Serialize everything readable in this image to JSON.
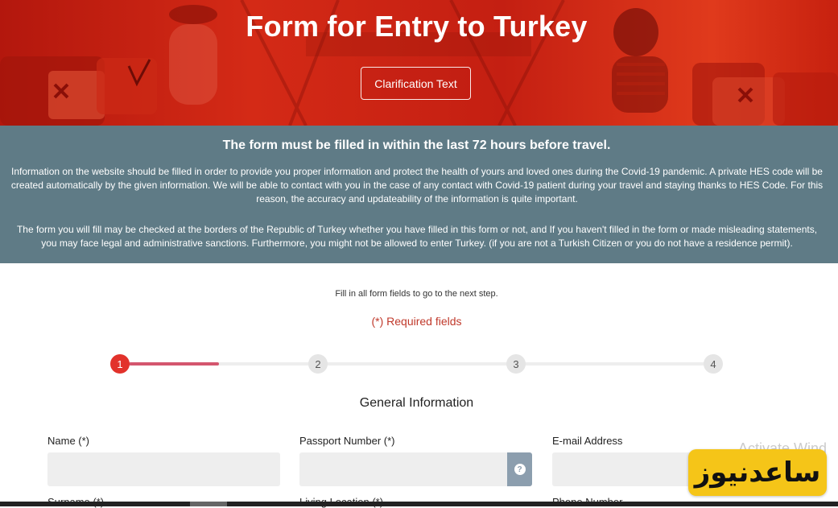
{
  "hero": {
    "title": "Form for Entry to Turkey",
    "clarification_button": "Clarification Text"
  },
  "info": {
    "heading": "The form must be filled in within the last 72 hours before travel.",
    "paragraph1": "Information on the website should be filled in order to provide you proper information and protect the health of yours and loved ones during the Covid-19 pandemic. A private HES code will be created automatically by the given information. We will be able to contact with you in the case of any contact with Covid-19 patient during your travel and staying thanks to HES Code. For this reason, the accuracy and updateability of the information is quite important.",
    "paragraph2": "The form you will fill may be checked at the borders of the Republic of Turkey whether you have filled in this form or not, and If you haven't filled in the form or made misleading statements, you may face legal and administrative sanctions. Furthermore, you might not be allowed to enter Turkey. (if you are not a Turkish Citizen or you do not have a residence permit)."
  },
  "form": {
    "instructions": "Fill in all form fields to go to the next step.",
    "required_note": "(*) Required fields",
    "steps": [
      "1",
      "2",
      "3",
      "4"
    ],
    "current_step": 1,
    "progress_fraction": 0.15,
    "section_title": "General Information",
    "fields": {
      "name": {
        "label": "Name (*)",
        "value": ""
      },
      "passport": {
        "label": "Passport Number (*)",
        "value": "",
        "help_icon": "question-circle-icon"
      },
      "email": {
        "label": "E-mail Address",
        "value": ""
      },
      "surname": {
        "label": "Surname (*)"
      },
      "living_location": {
        "label": "Living Location (*)"
      },
      "phone": {
        "label": "Phone Number"
      }
    }
  },
  "overlays": {
    "activate_windows": "Activate Wind",
    "watermark": "ساعدنیوز"
  },
  "colors": {
    "hero_red": "#c41f12",
    "info_band": "#5f7b86",
    "step_active": "#e2322b",
    "progress": "#d4566e",
    "required_text": "#c0392b",
    "help_button": "#8c9eae",
    "watermark_bg": "#f5c518"
  }
}
